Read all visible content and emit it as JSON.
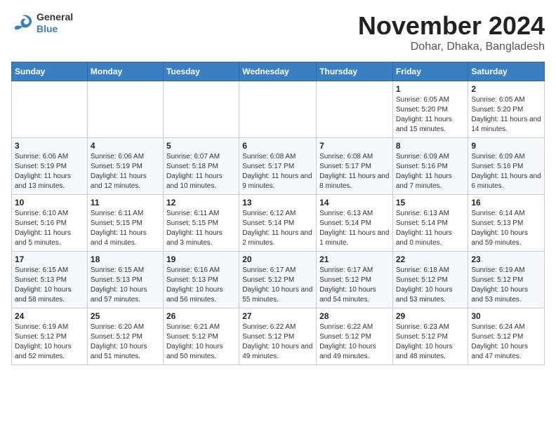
{
  "header": {
    "logo_general": "General",
    "logo_blue": "Blue",
    "month_title": "November 2024",
    "location": "Dohar, Dhaka, Bangladesh"
  },
  "weekdays": [
    "Sunday",
    "Monday",
    "Tuesday",
    "Wednesday",
    "Thursday",
    "Friday",
    "Saturday"
  ],
  "weeks": [
    [
      {
        "day": "",
        "info": ""
      },
      {
        "day": "",
        "info": ""
      },
      {
        "day": "",
        "info": ""
      },
      {
        "day": "",
        "info": ""
      },
      {
        "day": "",
        "info": ""
      },
      {
        "day": "1",
        "info": "Sunrise: 6:05 AM\nSunset: 5:20 PM\nDaylight: 11 hours and 15 minutes."
      },
      {
        "day": "2",
        "info": "Sunrise: 6:05 AM\nSunset: 5:20 PM\nDaylight: 11 hours and 14 minutes."
      }
    ],
    [
      {
        "day": "3",
        "info": "Sunrise: 6:06 AM\nSunset: 5:19 PM\nDaylight: 11 hours and 13 minutes."
      },
      {
        "day": "4",
        "info": "Sunrise: 6:06 AM\nSunset: 5:19 PM\nDaylight: 11 hours and 12 minutes."
      },
      {
        "day": "5",
        "info": "Sunrise: 6:07 AM\nSunset: 5:18 PM\nDaylight: 11 hours and 10 minutes."
      },
      {
        "day": "6",
        "info": "Sunrise: 6:08 AM\nSunset: 5:17 PM\nDaylight: 11 hours and 9 minutes."
      },
      {
        "day": "7",
        "info": "Sunrise: 6:08 AM\nSunset: 5:17 PM\nDaylight: 11 hours and 8 minutes."
      },
      {
        "day": "8",
        "info": "Sunrise: 6:09 AM\nSunset: 5:16 PM\nDaylight: 11 hours and 7 minutes."
      },
      {
        "day": "9",
        "info": "Sunrise: 6:09 AM\nSunset: 5:16 PM\nDaylight: 11 hours and 6 minutes."
      }
    ],
    [
      {
        "day": "10",
        "info": "Sunrise: 6:10 AM\nSunset: 5:16 PM\nDaylight: 11 hours and 5 minutes."
      },
      {
        "day": "11",
        "info": "Sunrise: 6:11 AM\nSunset: 5:15 PM\nDaylight: 11 hours and 4 minutes."
      },
      {
        "day": "12",
        "info": "Sunrise: 6:11 AM\nSunset: 5:15 PM\nDaylight: 11 hours and 3 minutes."
      },
      {
        "day": "13",
        "info": "Sunrise: 6:12 AM\nSunset: 5:14 PM\nDaylight: 11 hours and 2 minutes."
      },
      {
        "day": "14",
        "info": "Sunrise: 6:13 AM\nSunset: 5:14 PM\nDaylight: 11 hours and 1 minute."
      },
      {
        "day": "15",
        "info": "Sunrise: 6:13 AM\nSunset: 5:14 PM\nDaylight: 11 hours and 0 minutes."
      },
      {
        "day": "16",
        "info": "Sunrise: 6:14 AM\nSunset: 5:13 PM\nDaylight: 10 hours and 59 minutes."
      }
    ],
    [
      {
        "day": "17",
        "info": "Sunrise: 6:15 AM\nSunset: 5:13 PM\nDaylight: 10 hours and 58 minutes."
      },
      {
        "day": "18",
        "info": "Sunrise: 6:15 AM\nSunset: 5:13 PM\nDaylight: 10 hours and 57 minutes."
      },
      {
        "day": "19",
        "info": "Sunrise: 6:16 AM\nSunset: 5:13 PM\nDaylight: 10 hours and 56 minutes."
      },
      {
        "day": "20",
        "info": "Sunrise: 6:17 AM\nSunset: 5:12 PM\nDaylight: 10 hours and 55 minutes."
      },
      {
        "day": "21",
        "info": "Sunrise: 6:17 AM\nSunset: 5:12 PM\nDaylight: 10 hours and 54 minutes."
      },
      {
        "day": "22",
        "info": "Sunrise: 6:18 AM\nSunset: 5:12 PM\nDaylight: 10 hours and 53 minutes."
      },
      {
        "day": "23",
        "info": "Sunrise: 6:19 AM\nSunset: 5:12 PM\nDaylight: 10 hours and 53 minutes."
      }
    ],
    [
      {
        "day": "24",
        "info": "Sunrise: 6:19 AM\nSunset: 5:12 PM\nDaylight: 10 hours and 52 minutes."
      },
      {
        "day": "25",
        "info": "Sunrise: 6:20 AM\nSunset: 5:12 PM\nDaylight: 10 hours and 51 minutes."
      },
      {
        "day": "26",
        "info": "Sunrise: 6:21 AM\nSunset: 5:12 PM\nDaylight: 10 hours and 50 minutes."
      },
      {
        "day": "27",
        "info": "Sunrise: 6:22 AM\nSunset: 5:12 PM\nDaylight: 10 hours and 49 minutes."
      },
      {
        "day": "28",
        "info": "Sunrise: 6:22 AM\nSunset: 5:12 PM\nDaylight: 10 hours and 49 minutes."
      },
      {
        "day": "29",
        "info": "Sunrise: 6:23 AM\nSunset: 5:12 PM\nDaylight: 10 hours and 48 minutes."
      },
      {
        "day": "30",
        "info": "Sunrise: 6:24 AM\nSunset: 5:12 PM\nDaylight: 10 hours and 47 minutes."
      }
    ]
  ]
}
